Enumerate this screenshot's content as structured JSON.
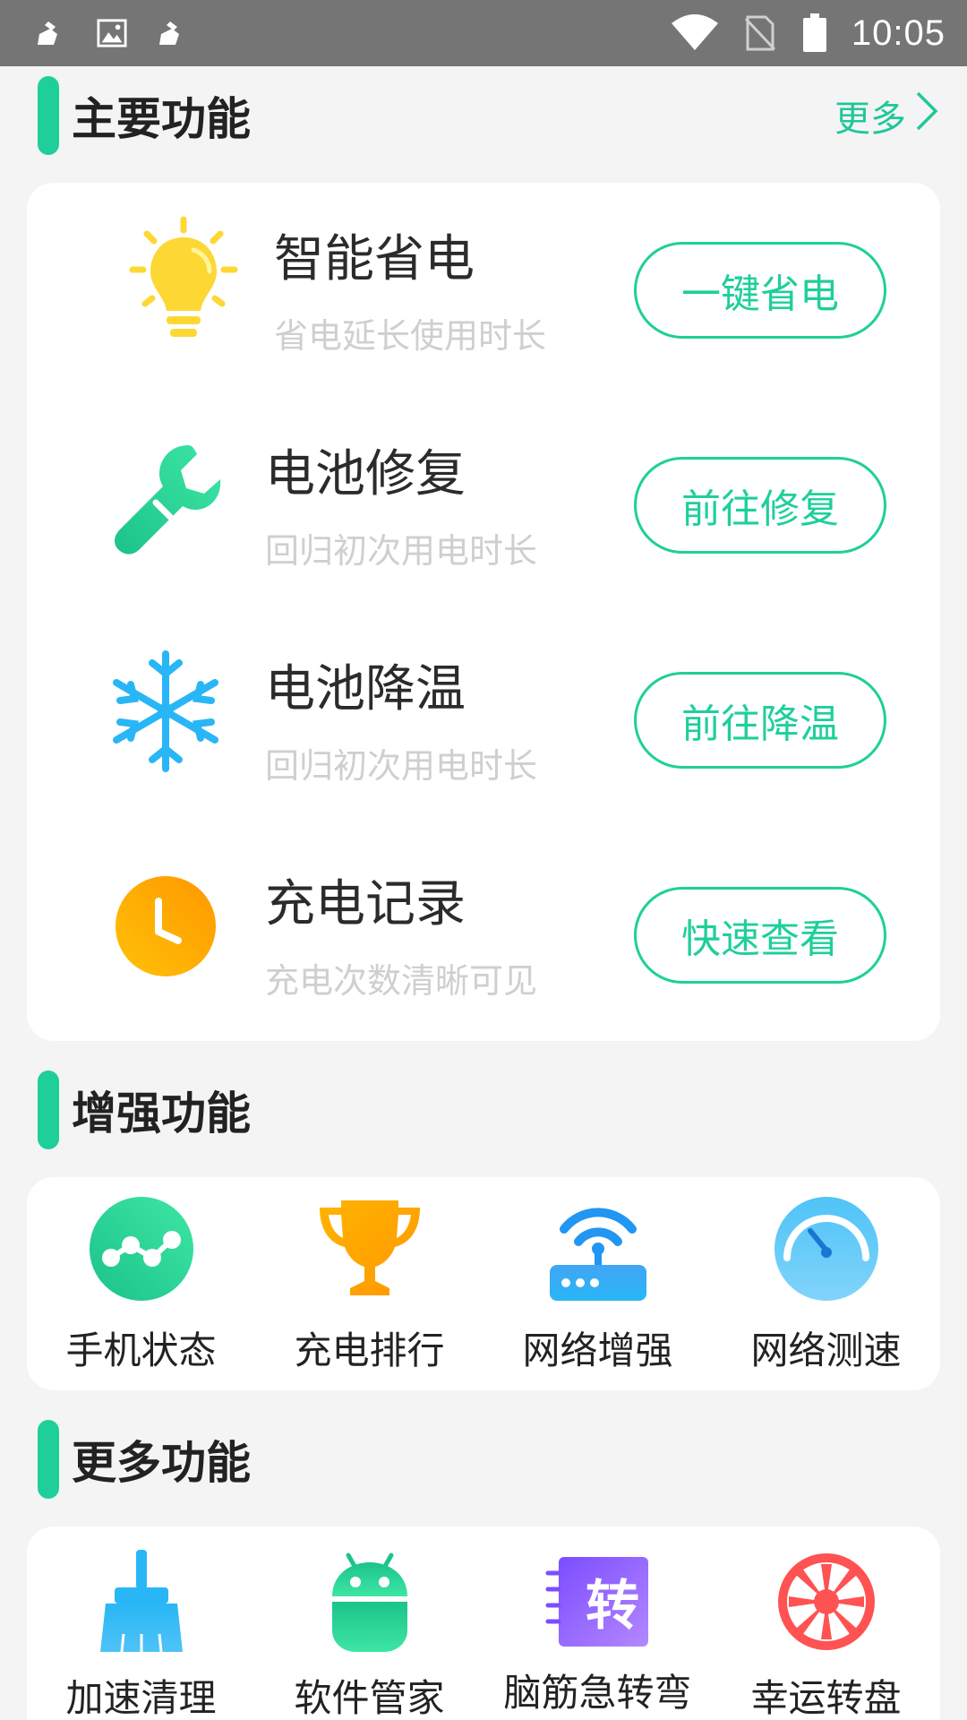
{
  "status_bar": {
    "time": "10:05",
    "left_icons": [
      "broom-icon",
      "image-icon",
      "broom-icon"
    ],
    "right_icons": [
      "wifi-icon",
      "no-sim-icon",
      "battery-icon"
    ]
  },
  "main_section": {
    "title": "主要功能",
    "more_label": "更多",
    "features": [
      {
        "title": "智能省电",
        "subtitle": "省电延长使用时长",
        "button": "一键省电",
        "icon": "lightbulb-icon"
      },
      {
        "title": "电池修复",
        "subtitle": "回归初次用电时长",
        "button": "前往修复",
        "icon": "wrench-icon"
      },
      {
        "title": "电池降温",
        "subtitle": "回归初次用电时长",
        "button": "前往降温",
        "icon": "snowflake-icon"
      },
      {
        "title": "充电记录",
        "subtitle": "充电次数清晰可见",
        "button": "快速查看",
        "icon": "clock-icon"
      }
    ]
  },
  "enhanced_section": {
    "title": "增强功能",
    "items": [
      {
        "label": "手机状态",
        "icon": "network-nodes-icon"
      },
      {
        "label": "充电排行",
        "icon": "trophy-icon"
      },
      {
        "label": "网络增强",
        "icon": "router-icon"
      },
      {
        "label": "网络测速",
        "icon": "speedometer-icon"
      }
    ]
  },
  "more_section": {
    "title": "更多功能",
    "items": [
      {
        "label": "加速清理",
        "icon": "broom-icon"
      },
      {
        "label": "软件管家",
        "icon": "android-icon"
      },
      {
        "label": "脑筋急转弯",
        "icon": "zhuan-icon",
        "icon_text": "转"
      },
      {
        "label": "幸运转盘",
        "icon": "lucky-wheel-icon"
      }
    ]
  },
  "colors": {
    "accent": "#1fcf9a",
    "status_bar": "#757575",
    "subtitle": "#cfcfcf",
    "background": "#f4f4f4"
  }
}
